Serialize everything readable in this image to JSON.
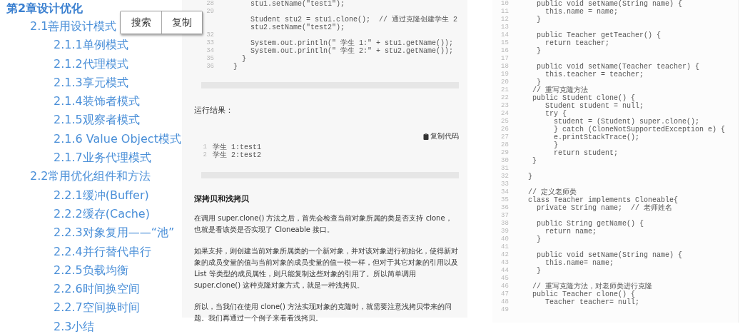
{
  "outline": {
    "items": [
      {
        "label": "第2章设计优化",
        "children": [
          {
            "label": "2.1善用设计模式",
            "children": [
              {
                "label": "2.1.1单例模式"
              },
              {
                "label": "2.1.2代理模式"
              },
              {
                "label": "2.1.3享元模式"
              },
              {
                "label": "2.1.4装饰者模式"
              },
              {
                "label": "2.1.5观察者模式"
              },
              {
                "label": "2.1.6 Value Object模式"
              },
              {
                "label": "2.1.7业务代理模式"
              }
            ]
          },
          {
            "label": "2.2常用优化组件和方法",
            "children": [
              {
                "label": "2.2.1缓冲(Buffer)"
              },
              {
                "label": "2.2.2缓存(Cache)"
              },
              {
                "label": "2.2.3对象复用——“池”"
              },
              {
                "label": "2.2.4并行替代串行"
              },
              {
                "label": "2.2.5负载均衡"
              },
              {
                "label": "2.2.6时间换空间"
              },
              {
                "label": "2.2.7空间换时间"
              },
              {
                "label": "2.3小结"
              }
            ]
          }
        ]
      }
    ]
  },
  "popup": {
    "buttons": [
      "搜索",
      "复制"
    ]
  },
  "article": {
    "code_lines": [
      {
        "num": "28",
        "text": "    stu1.setName(\"test1\");"
      },
      {
        "num": "29"
      },
      {
        "text": "    Student stu2 = stu1.clone();  // 通过克隆创建学生 2"
      },
      {
        "text": "    stu2.setName(\"test2\");"
      },
      {
        "num": "32"
      },
      {
        "num": "33",
        "text": "    System.out.println(\" 学生 1:\" + stu1.getName());"
      },
      {
        "num": "34",
        "text": "    System.out.println(\" 学生 2:\" + stu2.getName());"
      },
      {
        "num": "35",
        "text": "  }"
      },
      {
        "num": "36",
        "text": "}"
      }
    ],
    "result_label": "运行结果：",
    "copy_code": "复制代码",
    "output_lines": [
      {
        "num": "1",
        "text": "学生 1:test1"
      },
      {
        "num": "2",
        "text": "学生 2:test2"
      }
    ],
    "heading": "深拷贝和浅拷贝",
    "paragraphs": [
      "在调用 super.clone() 方法之后，首先会检查当前对象所属的类是否支持 clone，也就是看该类是否实现了 Cloneable 接口。",
      "如果支持，则创建当前对象所属类的一个新对象，并对该对象进行初始化，使得新对象的成员变量的值与当前对象的成员变量的值一模一样，但对于其它对象的引用以及 List 等类型的成员属性，则只能复制这些对象的引用了。所以简单调用 super.clone() 这种克隆对象方式，就是一种浅拷贝。",
      "所以，当我们在使用 clone() 方法实现对象的克隆时，就需要注意浅拷贝带来的问题。我们再通过一个例子来看看浅拷贝。"
    ]
  },
  "code_panel": {
    "lines": [
      {
        "num": "10",
        "text": "  public void setName(String name) {"
      },
      {
        "num": "11",
        "text": "    this.name = name;"
      },
      {
        "num": "12",
        "text": "  }"
      },
      {
        "num": "13"
      },
      {
        "num": "14",
        "text": "  public Teacher getTeacher() {"
      },
      {
        "num": "15",
        "text": "    return teacher;"
      },
      {
        "num": "16",
        "text": "  }"
      },
      {
        "num": "17"
      },
      {
        "num": "18",
        "text": "  public void setName(Teacher teacher) {"
      },
      {
        "num": "19",
        "text": "    this.teacher = teacher;"
      },
      {
        "num": "20",
        "text": "  }"
      },
      {
        "num": "21",
        "text": " // 重写克隆方法"
      },
      {
        "num": "22",
        "text": " public Student clone() {"
      },
      {
        "num": "23",
        "text": "    Student student = null;"
      },
      {
        "num": "24",
        "text": "    try {"
      },
      {
        "num": "25",
        "text": "      student = (Student) super.clone();"
      },
      {
        "num": "26",
        "text": "      } catch (CloneNotSupportedException e) {"
      },
      {
        "num": "27",
        "text": "      e.printStackTrace();"
      },
      {
        "num": "28",
        "text": "      }"
      },
      {
        "num": "29",
        "text": "      return student;"
      },
      {
        "num": "30",
        "text": " }"
      },
      {
        "num": "31"
      },
      {
        "num": "32",
        "text": "}"
      },
      {
        "num": "33"
      },
      {
        "num": "34",
        "text": "// 定义老师类"
      },
      {
        "num": "35",
        "text": "class Teacher implements Cloneable{"
      },
      {
        "num": "36",
        "text": "  private String name;  // 老师姓名"
      },
      {
        "num": "37"
      },
      {
        "num": "38",
        "text": "  public String getName() {"
      },
      {
        "num": "39",
        "text": "    return name;"
      },
      {
        "num": "40",
        "text": "  }"
      },
      {
        "num": "41"
      },
      {
        "num": "42",
        "text": "  public void setName(String name) {"
      },
      {
        "num": "43",
        "text": "    this.name= name;"
      },
      {
        "num": "44",
        "text": "  }"
      },
      {
        "num": "45"
      },
      {
        "num": "46",
        "text": " // 重写克隆方法，对老师类进行克隆"
      },
      {
        "num": "47",
        "text": " public Teacher clone() {"
      },
      {
        "num": "48",
        "text": "    Teacher teacher= null;"
      },
      {
        "num": "49"
      }
    ]
  }
}
